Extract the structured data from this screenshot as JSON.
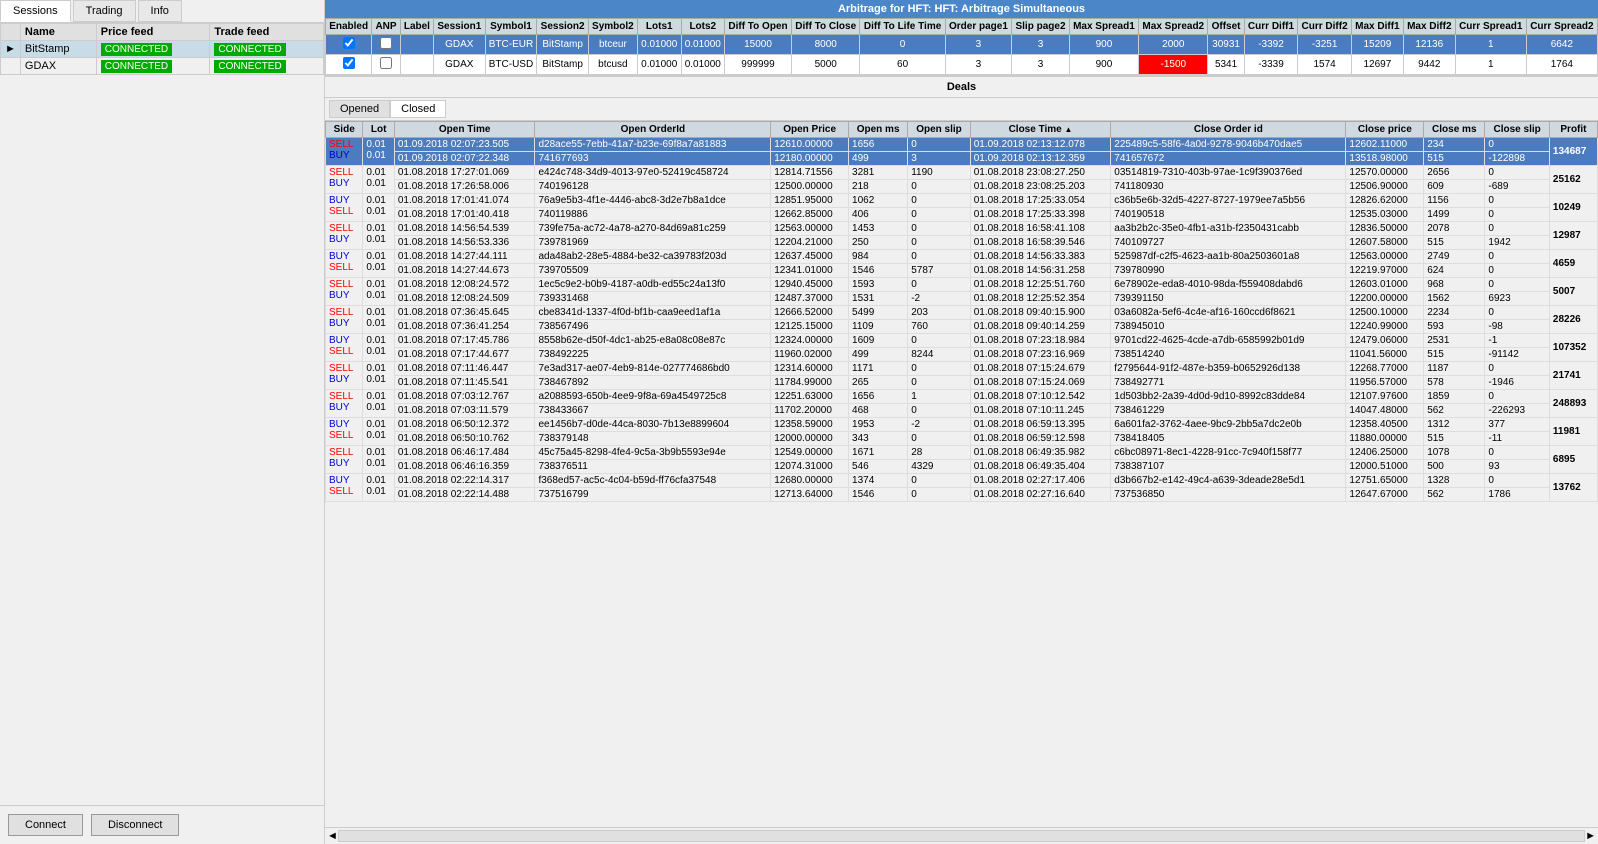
{
  "title": "Arbitrage for HFT: HFT: Arbitrage Simultaneous",
  "leftPanel": {
    "tabs": [
      "Sessions",
      "Trading",
      "Info"
    ],
    "activeTab": "Sessions",
    "tableHeaders": [
      "Name",
      "Price feed",
      "Trade feed"
    ],
    "sessions": [
      {
        "name": "BitStamp",
        "priceFeed": "CONNECTED",
        "tradeFeed": "CONNECTED",
        "selected": true,
        "arrow": true
      },
      {
        "name": "GDAX",
        "priceFeed": "CONNECTED",
        "tradeFeed": "CONNECTED",
        "selected": false,
        "arrow": false
      }
    ],
    "buttons": [
      "Connect",
      "Disconnect"
    ]
  },
  "topTable": {
    "headers": [
      "Enabled",
      "ANP",
      "Label",
      "Session1",
      "Symbol1",
      "Session2",
      "Symbol2",
      "Lots1",
      "Lots2",
      "Diff To Open",
      "Diff To Close",
      "Diff To Life Time",
      "Order page1",
      "Slip page2",
      "Max Spread1",
      "Max Spread2",
      "Offset",
      "Curr Diff1",
      "Curr Diff2",
      "Max Diff1",
      "Max Diff2",
      "Curr Spread1",
      "Curr Spread2"
    ],
    "rows": [
      {
        "enabled": true,
        "anp": false,
        "label": "",
        "session1": "GDAX",
        "symbol1": "BTC-EUR",
        "session2": "BitStamp",
        "symbol2": "btceur",
        "lots1": "0.01000",
        "lots2": "0.01000",
        "diffOpen": "15000",
        "diffClose": "8000",
        "diffLifeTime": "0",
        "orderPage1": "3",
        "slipPage2": "3",
        "maxSpread1": "900",
        "maxSpread2": "2000",
        "offset": "30931",
        "currDiff1": "-3392",
        "currDiff2": "-3251",
        "maxDiff1": "15209",
        "maxDiff2": "12136",
        "currSpread1": "1",
        "currSpread2": "6642",
        "rowClass": "row-blue",
        "redCell": false
      },
      {
        "enabled": true,
        "anp": false,
        "label": "",
        "session1": "GDAX",
        "symbol1": "BTC-USD",
        "session2": "BitStamp",
        "symbol2": "btcusd",
        "lots1": "0.01000",
        "lots2": "0.01000",
        "diffOpen": "999999",
        "diffClose": "5000",
        "diffLifeTime": "60",
        "orderPage1": "3",
        "slipPage2": "3",
        "maxSpread1": "900",
        "maxSpread2": "-1500",
        "offset": "5341",
        "currDiff1": "-3339",
        "currDiff2": "1574",
        "maxDiff1": "12697",
        "maxDiff2": "9442",
        "currSpread1": "1",
        "currSpread2": "1764",
        "rowClass": "row-white",
        "redCell": true
      }
    ]
  },
  "deals": {
    "title": "Deals",
    "tabs": [
      "Opened",
      "Closed"
    ],
    "activeTab": "Closed",
    "tableHeaders": [
      "Side",
      "Lot",
      "Open Time",
      "Open OrderId",
      "Open Price",
      "Open ms",
      "Open slip",
      "Close Time",
      "Close Order id",
      "Close price",
      "Close ms",
      "Close slip",
      "Profit"
    ],
    "rows": [
      {
        "side": [
          "SELL",
          "BUY"
        ],
        "lot": [
          "0.01",
          "0.01"
        ],
        "openTime": [
          "01.09.2018 02:07:23.505",
          "01.09.2018 02:07:22.348"
        ],
        "openOrderId": [
          "d28ace55-7ebb-41a7-b23e-69f8a7a81883",
          "741677693"
        ],
        "openPrice": [
          "12610.00000",
          "12180.00000"
        ],
        "openMs": [
          "1656",
          "499"
        ],
        "openSlip": [
          "0",
          "3"
        ],
        "closeTime": [
          "01.09.2018 02:13:12.078",
          "01.09.2018 02:13:12.359"
        ],
        "closeOrderId": [
          "225489c5-58f6-4a0d-9278-9046b470dae5",
          "741657672"
        ],
        "closePrice": [
          "12602.11000",
          "13518.98000"
        ],
        "closeMs": [
          "234",
          "515"
        ],
        "closeSlip": [
          "0",
          "-122898"
        ],
        "profit": "134687",
        "highlight": true
      },
      {
        "side": [
          "SELL",
          "BUY"
        ],
        "lot": [
          "0.01",
          "0.01"
        ],
        "openTime": [
          "01.08.2018 17:27:01.069",
          "01.08.2018 17:26:58.006"
        ],
        "openOrderId": [
          "e424c748-34d9-4013-97e0-52419c458724",
          "740196128"
        ],
        "openPrice": [
          "12814.71556",
          "12500.00000"
        ],
        "openMs": [
          "3281",
          "218"
        ],
        "openSlip": [
          "1190",
          "0"
        ],
        "closeTime": [
          "01.08.2018 23:08:27.250",
          "01.08.2018 23:08:25.203"
        ],
        "closeOrderId": [
          "03514819-7310-403b-97ae-1c9f390376ed",
          "741180930"
        ],
        "closePrice": [
          "12570.00000",
          "12506.90000"
        ],
        "closeMs": [
          "2656",
          "609"
        ],
        "closeSlip": [
          "0",
          "-689"
        ],
        "profit": "25162",
        "highlight": false
      },
      {
        "side": [
          "BUY",
          "SELL"
        ],
        "lot": [
          "0.01",
          "0.01"
        ],
        "openTime": [
          "01.08.2018 17:01:41.074",
          "01.08.2018 17:01:40.418"
        ],
        "openOrderId": [
          "76a9e5b3-4f1e-4446-abc8-3d2e7b8a1dce",
          "740119886"
        ],
        "openPrice": [
          "12851.95000",
          "12662.85000"
        ],
        "openMs": [
          "1062",
          "406"
        ],
        "openSlip": [
          "0",
          "0"
        ],
        "closeTime": [
          "01.08.2018 17:25:33.054",
          "01.08.2018 17:25:33.398"
        ],
        "closeOrderId": [
          "c36b5e6b-32d5-4227-8727-1979ee7a5b56",
          "740190518"
        ],
        "closePrice": [
          "12826.62000",
          "12535.03000"
        ],
        "closeMs": [
          "1156",
          "1499"
        ],
        "closeSlip": [
          "0",
          "0"
        ],
        "profit": "10249",
        "highlight": false
      },
      {
        "side": [
          "SELL",
          "BUY"
        ],
        "lot": [
          "0.01",
          "0.01"
        ],
        "openTime": [
          "01.08.2018 14:56:54.539",
          "01.08.2018 14:56:53.336"
        ],
        "openOrderId": [
          "739fe75a-ac72-4a78-a270-84d69a81c259",
          "739781969"
        ],
        "openPrice": [
          "12563.00000",
          "12204.21000"
        ],
        "openMs": [
          "1453",
          "250"
        ],
        "openSlip": [
          "0",
          "0"
        ],
        "closeTime": [
          "01.08.2018 16:58:41.108",
          "01.08.2018 16:58:39.546"
        ],
        "closeOrderId": [
          "aa3b2b2c-35e0-4fb1-a31b-f2350431cabb",
          "740109727"
        ],
        "closePrice": [
          "12836.50000",
          "12607.58000"
        ],
        "closeMs": [
          "2078",
          "515"
        ],
        "closeSlip": [
          "0",
          "1942"
        ],
        "profit": "12987",
        "highlight": false
      },
      {
        "side": [
          "BUY",
          "SELL"
        ],
        "lot": [
          "0.01",
          "0.01"
        ],
        "openTime": [
          "01.08.2018 14:27:44.111",
          "01.08.2018 14:27:44.673"
        ],
        "openOrderId": [
          "ada48ab2-28e5-4884-be32-ca39783f203d",
          "739705509"
        ],
        "openPrice": [
          "12637.45000",
          "12341.01000"
        ],
        "openMs": [
          "984",
          "1546"
        ],
        "openSlip": [
          "0",
          "5787"
        ],
        "closeTime": [
          "01.08.2018 14:56:33.383",
          "01.08.2018 14:56:31.258"
        ],
        "closeOrderId": [
          "525987df-c2f5-4623-aa1b-80a2503601a8",
          "739780990"
        ],
        "closePrice": [
          "12563.00000",
          "12219.97000"
        ],
        "closeMs": [
          "2749",
          "624"
        ],
        "closeSlip": [
          "0",
          "0"
        ],
        "profit": "4659",
        "highlight": false
      },
      {
        "side": [
          "SELL",
          "BUY"
        ],
        "lot": [
          "0.01",
          "0.01"
        ],
        "openTime": [
          "01.08.2018 12:08:24.572",
          "01.08.2018 12:08:24.509"
        ],
        "openOrderId": [
          "1ec5c9e2-b0b9-4187-a0db-ed55c24a13f0",
          "739331468"
        ],
        "openPrice": [
          "12940.45000",
          "12487.37000"
        ],
        "openMs": [
          "1593",
          "1531"
        ],
        "openSlip": [
          "0",
          "-2"
        ],
        "closeTime": [
          "01.08.2018 12:25:51.760",
          "01.08.2018 12:25:52.354"
        ],
        "closeOrderId": [
          "6e78902e-eda8-4010-98da-f559408dabd6",
          "739391150"
        ],
        "closePrice": [
          "12603.01000",
          "12200.00000"
        ],
        "closeMs": [
          "968",
          "1562"
        ],
        "closeSlip": [
          "0",
          "6923"
        ],
        "profit": "5007",
        "highlight": false
      },
      {
        "side": [
          "SELL",
          "BUY"
        ],
        "lot": [
          "0.01",
          "0.01"
        ],
        "openTime": [
          "01.08.2018 07:36:45.645",
          "01.08.2018 07:36:41.254"
        ],
        "openOrderId": [
          "cbe8341d-1337-4f0d-bf1b-caa9eed1af1a",
          "738567496"
        ],
        "openPrice": [
          "12666.52000",
          "12125.15000"
        ],
        "openMs": [
          "5499",
          "1109"
        ],
        "openSlip": [
          "203",
          "760"
        ],
        "closeTime": [
          "01.08.2018 09:40:15.900",
          "01.08.2018 09:40:14.259"
        ],
        "closeOrderId": [
          "03a6082a-5ef6-4c4e-af16-160ccd6f8621",
          "738945010"
        ],
        "closePrice": [
          "12500.10000",
          "12240.99000"
        ],
        "closeMs": [
          "2234",
          "593"
        ],
        "closeSlip": [
          "0",
          "-98"
        ],
        "profit": "28226",
        "highlight": false
      },
      {
        "side": [
          "BUY",
          "SELL"
        ],
        "lot": [
          "0.01",
          "0.01"
        ],
        "openTime": [
          "01.08.2018 07:17:45.786",
          "01.08.2018 07:17:44.677"
        ],
        "openOrderId": [
          "8558b62e-d50f-4dc1-ab25-e8a08c08e87c",
          "738492225"
        ],
        "openPrice": [
          "12324.00000",
          "11960.02000"
        ],
        "openMs": [
          "1609",
          "499"
        ],
        "openSlip": [
          "0",
          "8244"
        ],
        "closeTime": [
          "01.08.2018 07:23:18.984",
          "01.08.2018 07:23:16.969"
        ],
        "closeOrderId": [
          "9701cd22-4625-4cde-a7db-6585992b01d9",
          "738514240"
        ],
        "closePrice": [
          "12479.06000",
          "11041.56000"
        ],
        "closeMs": [
          "2531",
          "515"
        ],
        "closeSlip": [
          "-1",
          "-91142"
        ],
        "profit": "107352",
        "highlight": false
      },
      {
        "side": [
          "SELL",
          "BUY"
        ],
        "lot": [
          "0.01",
          "0.01"
        ],
        "openTime": [
          "01.08.2018 07:11:46.447",
          "01.08.2018 07:11:45.541"
        ],
        "openOrderId": [
          "7e3ad317-ae07-4eb9-814e-027774686bd0",
          "738467892"
        ],
        "openPrice": [
          "12314.60000",
          "11784.99000"
        ],
        "openMs": [
          "1171",
          "265"
        ],
        "openSlip": [
          "0",
          "0"
        ],
        "closeTime": [
          "01.08.2018 07:15:24.679",
          "01.08.2018 07:15:24.069"
        ],
        "closeOrderId": [
          "f2795644-91f2-487e-b359-b0652926d138",
          "738492771"
        ],
        "closePrice": [
          "12268.77000",
          "11956.57000"
        ],
        "closeMs": [
          "1187",
          "578"
        ],
        "closeSlip": [
          "0",
          "-1946"
        ],
        "profit": "21741",
        "highlight": false
      },
      {
        "side": [
          "SELL",
          "BUY"
        ],
        "lot": [
          "0.01",
          "0.01"
        ],
        "openTime": [
          "01.08.2018 07:03:12.767",
          "01.08.2018 07:03:11.579"
        ],
        "openOrderId": [
          "a2088593-650b-4ee9-9f8a-69a4549725c8",
          "738433667"
        ],
        "openPrice": [
          "12251.63000",
          "11702.20000"
        ],
        "openMs": [
          "1656",
          "468"
        ],
        "openSlip": [
          "1",
          "0"
        ],
        "closeTime": [
          "01.08.2018 07:10:12.542",
          "01.08.2018 07:10:11.245"
        ],
        "closeOrderId": [
          "1d503bb2-2a39-4d0d-9d10-8992c83dde84",
          "738461229"
        ],
        "closePrice": [
          "12107.97600",
          "14047.48000"
        ],
        "closeMs": [
          "1859",
          "562"
        ],
        "closeSlip": [
          "0",
          "-226293"
        ],
        "profit": "248893",
        "highlight": false
      },
      {
        "side": [
          "BUY",
          "SELL"
        ],
        "lot": [
          "0.01",
          "0.01"
        ],
        "openTime": [
          "01.08.2018 06:50:12.372",
          "01.08.2018 06:50:10.762"
        ],
        "openOrderId": [
          "ee1456b7-d0de-44ca-8030-7b13e8899604",
          "738379148"
        ],
        "openPrice": [
          "12358.59000",
          "12000.00000"
        ],
        "openMs": [
          "1953",
          "343"
        ],
        "openSlip": [
          "-2",
          "0"
        ],
        "closeTime": [
          "01.08.2018 06:59:13.395",
          "01.08.2018 06:59:12.598"
        ],
        "closeOrderId": [
          "6a601fa2-3762-4aee-9bc9-2bb5a7dc2e0b",
          "738418405"
        ],
        "closePrice": [
          "12358.40500",
          "11880.00000"
        ],
        "closeMs": [
          "1312",
          "515"
        ],
        "closeSlip": [
          "377",
          "-11"
        ],
        "profit": "11981",
        "highlight": false
      },
      {
        "side": [
          "SELL",
          "BUY"
        ],
        "lot": [
          "0.01",
          "0.01"
        ],
        "openTime": [
          "01.08.2018 06:46:17.484",
          "01.08.2018 06:46:16.359"
        ],
        "openOrderId": [
          "45c75a45-8298-4fe4-9c5a-3b9b5593e94e",
          "738376511"
        ],
        "openPrice": [
          "12549.00000",
          "12074.31000"
        ],
        "openMs": [
          "1671",
          "546"
        ],
        "openSlip": [
          "28",
          "4329"
        ],
        "closeTime": [
          "01.08.2018 06:49:35.982",
          "01.08.2018 06:49:35.404"
        ],
        "closeOrderId": [
          "c6bc08971-8ec1-4228-91cc-7c940f158f77",
          "738387107"
        ],
        "closePrice": [
          "12406.25000",
          "12000.51000"
        ],
        "closeMs": [
          "1078",
          "500"
        ],
        "closeSlip": [
          "0",
          "93"
        ],
        "profit": "6895",
        "highlight": false
      },
      {
        "side": [
          "BUY",
          "SELL"
        ],
        "lot": [
          "0.01",
          "0.01"
        ],
        "openTime": [
          "01.08.2018 02:22:14.317",
          "01.08.2018 02:22:14.488"
        ],
        "openOrderId": [
          "f368ed57-ac5c-4c04-b59d-ff76cfa37548",
          "737516799"
        ],
        "openPrice": [
          "12680.00000",
          "12713.64000"
        ],
        "openMs": [
          "1374",
          "1546"
        ],
        "openSlip": [
          "0",
          "0"
        ],
        "closeTime": [
          "01.08.2018 02:27:17.406",
          "01.08.2018 02:27:16.640"
        ],
        "closeOrderId": [
          "d3b667b2-e142-49c4-a639-3deade28e5d1",
          "737536850"
        ],
        "closePrice": [
          "12751.65000",
          "12647.67000"
        ],
        "closeMs": [
          "1328",
          "562"
        ],
        "closeSlip": [
          "0",
          "1786"
        ],
        "profit": "13762",
        "highlight": false
      }
    ]
  }
}
